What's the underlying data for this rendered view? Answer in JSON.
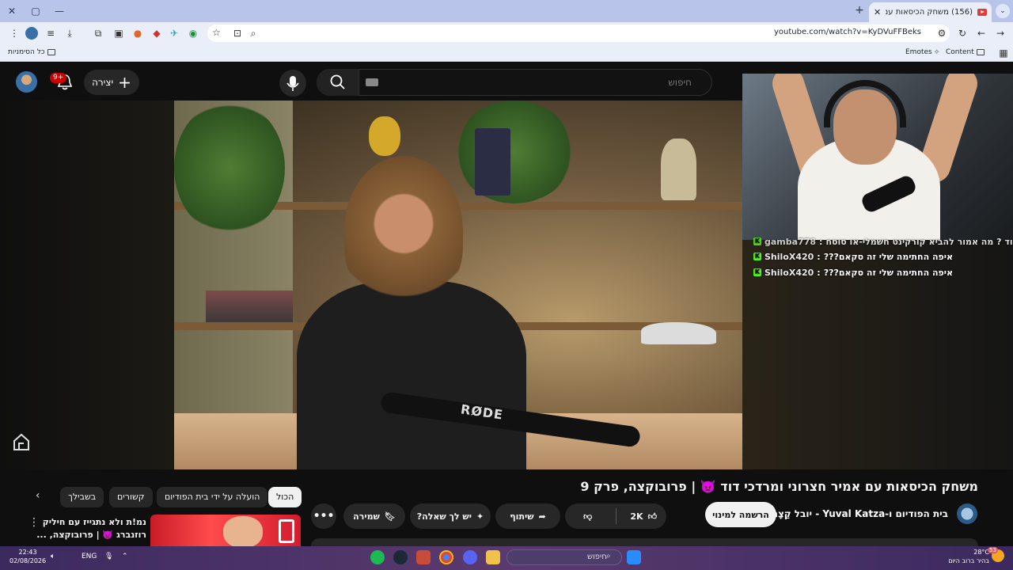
{
  "browser": {
    "tab_title": "(156) משחק הכיסאות עם אמיר",
    "url": "youtube.com/watch?v=KyDVuFFBeks",
    "bookmarks": {
      "all_bookmarks": "כל הסימניות",
      "emotes": "Emotes",
      "content": "Content"
    }
  },
  "youtube": {
    "create_label": "יצירה",
    "notification_count": "9+",
    "search_placeholder": "חיפוש",
    "video": {
      "title": "משחק הכיסאות עם אמיר חצרוני ומרדכי דוד 👿 | פרובוקצה, פרק 9",
      "brand_text": "RØDE"
    },
    "channel": {
      "name": "בית הפודיום ו-Yuval Katza - יובל קַצָה"
    },
    "actions": {
      "subscribe": "הרשמה למינוי",
      "likes": "2K",
      "share": "שיתוף",
      "ask": "יש לך שאלה?",
      "save": "שמירה",
      "more": "•••"
    },
    "chips": [
      "הכול",
      "הועלה על ידי בית הפודיום",
      "קשורים",
      "בשבילך"
    ],
    "related": {
      "title": "נמ!ת ולא נתגייז עם חיליק רוזנברג 👿 | פרובוקצה, ..."
    }
  },
  "stream_overlay": {
    "chat": [
      {
        "user": "gamba778",
        "message": "עוד ? מה אמור להביא קורקינט חשמלי-או סוסח"
      },
      {
        "user": "ShiloX420",
        "message": "איפה החתימה שלי זה סקאם???"
      },
      {
        "user": "ShiloX420",
        "message": "איפה החתימה שלי זה סקאם???"
      }
    ]
  },
  "taskbar": {
    "time": "22:43",
    "date": "02/08/2026",
    "language": "ENG",
    "search_placeholder": "חיפוש",
    "weather_temp": "28°C",
    "weather_desc": "בהיר ברוב היום",
    "weather_badge": "53"
  },
  "colors": {
    "yt_background": "#0f0f0f",
    "yt_red": "#cc0000",
    "kick_green": "#53fc18",
    "chrome_frame": "#b9c4ea"
  }
}
